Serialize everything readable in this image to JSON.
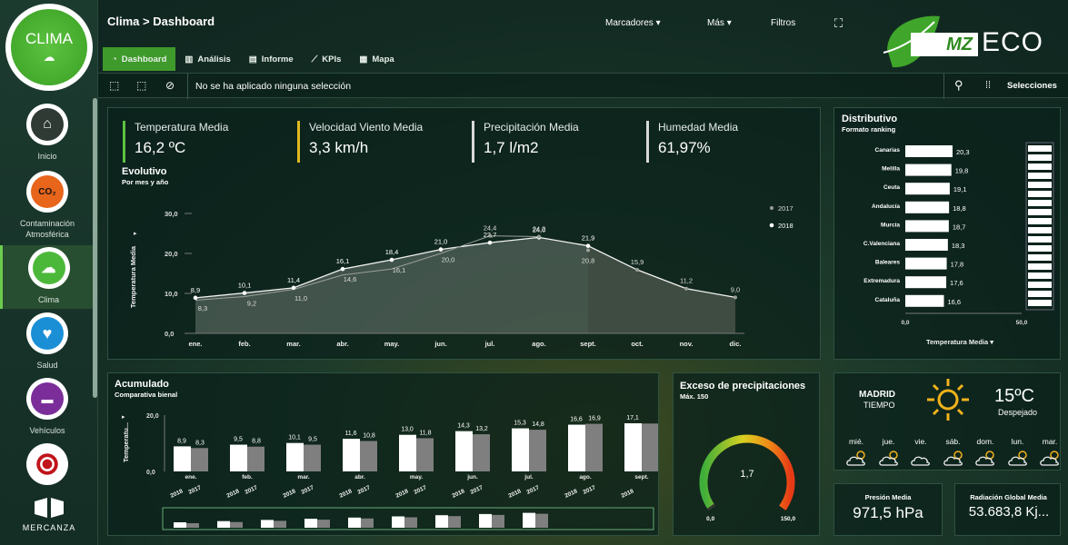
{
  "app": {
    "logo_text": "CLIMA",
    "brand": "MERCANZA",
    "brand_logo_letters": "MZ",
    "brand_logo_word": "ECO",
    "accent": "#3f9a2c"
  },
  "breadcrumb": "Clima > Dashboard",
  "top_menu": [
    "Marcadores",
    "Más",
    "Filtros"
  ],
  "tabs": [
    {
      "label": "Dashboard",
      "icon": "gauge-icon",
      "active": true
    },
    {
      "label": "Análisis",
      "icon": "bar-chart-icon"
    },
    {
      "label": "Informe",
      "icon": "printer-icon"
    },
    {
      "label": "KPIs",
      "icon": "line-chart-icon"
    },
    {
      "label": "Mapa",
      "icon": "map-icon"
    }
  ],
  "selection": {
    "text": "No se ha aplicado ninguna selección",
    "selections_label": "Selecciones"
  },
  "sidebar": [
    {
      "label": "Inicio",
      "icon": "home-icon"
    },
    {
      "label": "Contaminación Atmosférica",
      "icon": "co2-icon",
      "badge": "CO₂"
    },
    {
      "label": "Clima",
      "icon": "weather-icon",
      "active": true
    },
    {
      "label": "Salud",
      "icon": "heart-icon"
    },
    {
      "label": "Vehículos",
      "icon": "truck-icon"
    },
    {
      "label": "",
      "icon": "target-icon"
    }
  ],
  "kpis": [
    {
      "label": "Temperatura Media",
      "value": "16,2 ºC",
      "color": "#5cc240"
    },
    {
      "label": "Velocidad Viento Media",
      "value": "3,3 km/h",
      "color": "#e0b820"
    },
    {
      "label": "Precipitación Media",
      "value": "1,7 l/m2",
      "color": "#d9d9d9"
    },
    {
      "label": "Humedad Media",
      "value": "61,97%",
      "color": "#d9d9d9"
    }
  ],
  "evolutivo": {
    "title": "Evolutivo",
    "subtitle": "Por mes y año",
    "chart_data": {
      "type": "line",
      "ylabel": "Temperatura Media",
      "ylim": [
        0,
        30
      ],
      "yticks": [
        "0,0",
        "10,0",
        "20,0",
        "30,0"
      ],
      "categories": [
        "ene.",
        "feb.",
        "mar.",
        "abr.",
        "may.",
        "jun.",
        "jul.",
        "ago.",
        "sept.",
        "oct.",
        "nov.",
        "dic."
      ],
      "series": [
        {
          "name": "2017",
          "values": [
            null,
            null,
            null,
            null,
            null,
            null,
            24.4,
            24.2,
            20.8,
            15.9,
            11.2,
            9.0
          ],
          "labels": [
            "",
            "",
            "",
            "",
            "",
            "",
            "24,4",
            "24,2",
            "20,8",
            "15,9",
            "11,2",
            "9,0"
          ]
        },
        {
          "name": "2018",
          "values": [
            8.9,
            10.1,
            11.4,
            16.1,
            18.4,
            21.0,
            22.7,
            24.0,
            21.9,
            null,
            null,
            null
          ],
          "labels": [
            "8,9",
            "10,1",
            "11,4",
            "16,1",
            "18,4",
            "21,0",
            "22,7",
            "24,0",
            "21,9",
            "",
            "",
            ""
          ]
        }
      ],
      "extra_labels": {
        "low_2017": [
          "8,3",
          "9,2",
          "11,0",
          "14,6",
          "16,1",
          "20,0"
        ]
      },
      "legend": "top-right"
    }
  },
  "distributivo": {
    "title": "Distributivo",
    "subtitle": "Formato ranking",
    "chart_data": {
      "type": "bar",
      "orientation": "horizontal",
      "categories": [
        "Canarias",
        "Melilla",
        "Ceuta",
        "Andalucía",
        "Murcia",
        "C.Valenciana",
        "Baleares",
        "Extremadura",
        "Cataluña"
      ],
      "values": [
        20.3,
        19.8,
        19.1,
        18.8,
        18.7,
        18.3,
        17.8,
        17.6,
        16.6
      ],
      "labels": [
        "20,3",
        "19,8",
        "19,1",
        "18,8",
        "18,7",
        "18,3",
        "17,8",
        "17,6",
        "16,6"
      ],
      "xlim": [
        0,
        50
      ],
      "xticks": [
        "0,0",
        "50,0"
      ],
      "xlabel": "Temperatura Media"
    }
  },
  "acumulado": {
    "title": "Acumulado",
    "subtitle": "Comparativa bienal",
    "chart_data": {
      "type": "bar",
      "ylabel": "Temperatu...",
      "ylim": [
        0,
        20
      ],
      "yticks": [
        "0,0",
        "20,0"
      ],
      "categories": [
        "ene.",
        "feb.",
        "mar.",
        "abr.",
        "may.",
        "jun.",
        "jul.",
        "ago.",
        "sept."
      ],
      "series": [
        {
          "name": "2018",
          "values": [
            8.9,
            9.5,
            10.1,
            11.6,
            13.0,
            14.3,
            15.3,
            16.6,
            17.1
          ],
          "labels": [
            "8,9",
            "9,5",
            "10,1",
            "11,6",
            "13,0",
            "14,3",
            "15,3",
            "16,6",
            "17,1"
          ]
        },
        {
          "name": "2017",
          "values": [
            8.3,
            8.8,
            9.5,
            10.8,
            11.8,
            13.2,
            14.8,
            16.9,
            17.0
          ],
          "labels": [
            "8,3",
            "8,8",
            "9,5",
            "10,8",
            "11,8",
            "13,2",
            "14,8",
            "16,9",
            ""
          ]
        }
      ]
    }
  },
  "exceso": {
    "title": "Exceso de precipitaciones",
    "subtitle": "Máx. 150",
    "value": 1.7,
    "value_label": "1,7",
    "min_label": "0,0",
    "max_label": "150,0",
    "max": 150
  },
  "weather": {
    "city": "MADRID",
    "label": "TIEMPO",
    "temp": "15ºC",
    "condition": "Despejado",
    "days": [
      {
        "d": "mié.",
        "icon": "partly-cloudy-icon"
      },
      {
        "d": "jue.",
        "icon": "partly-cloudy-icon"
      },
      {
        "d": "vie.",
        "icon": "cloudy-icon"
      },
      {
        "d": "sáb.",
        "icon": "partly-cloudy-icon"
      },
      {
        "d": "dom.",
        "icon": "partly-cloudy-icon"
      },
      {
        "d": "lun.",
        "icon": "partly-cloudy-icon"
      },
      {
        "d": "mar.",
        "icon": "partly-cloudy-icon"
      }
    ]
  },
  "presion": {
    "label": "Presión Media",
    "value": "971,5 hPa"
  },
  "radiacion": {
    "label": "Radiación Global Media",
    "value": "53.683,8 Kj..."
  }
}
